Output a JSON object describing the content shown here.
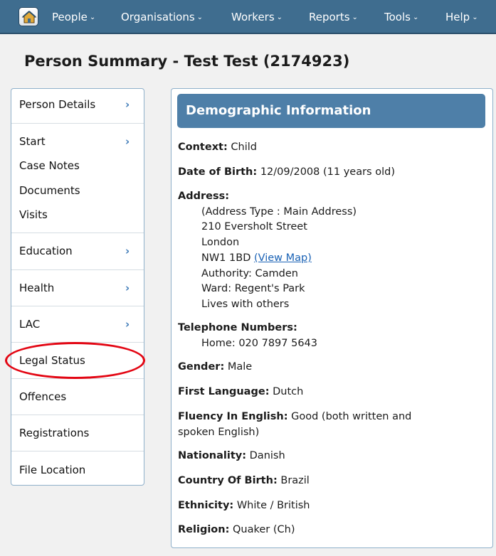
{
  "nav": {
    "items": [
      {
        "label": "People",
        "chev": "⌄"
      },
      {
        "label": "Organisations",
        "chev": "⌄"
      },
      {
        "label": "Workers",
        "chev": "⌄"
      },
      {
        "label": "Reports",
        "chev": "⌄"
      },
      {
        "label": "Tools",
        "chev": "⌄"
      },
      {
        "label": "Help",
        "chev": "⌄"
      }
    ],
    "home_icon": "home-icon"
  },
  "page_title": "Person Summary - Test Test (2174923)",
  "sidebar": {
    "items": [
      {
        "label": "Person Details",
        "arrow": "›"
      },
      {
        "label": "Start",
        "arrow": "›"
      },
      {
        "label": "Case Notes"
      },
      {
        "label": "Documents"
      },
      {
        "label": "Visits"
      },
      {
        "label": "Education",
        "arrow": "›"
      },
      {
        "label": "Health",
        "arrow": "›"
      },
      {
        "label": "LAC",
        "arrow": "›"
      },
      {
        "label": "Legal Status"
      },
      {
        "label": "Offences"
      },
      {
        "label": "Registrations"
      },
      {
        "label": "File Location"
      }
    ],
    "highlight_color": "#e30613"
  },
  "demographics": {
    "header": "Demographic Information",
    "context": {
      "label": "Context",
      "value": "Child"
    },
    "dob": {
      "label": "Date of Birth",
      "value": "12/09/2008 (11 years old)"
    },
    "address": {
      "label": "Address",
      "lines": [
        "(Address Type : Main Address)",
        "210 Eversholt Street",
        "London",
        "NW1 1BD"
      ],
      "map_link": "(View Map)",
      "extra": [
        "Authority: Camden",
        "Ward: Regent's Park",
        "Lives with others"
      ]
    },
    "telephone": {
      "label": "Telephone Numbers",
      "value": "Home: 020 7897 5643"
    },
    "gender": {
      "label": "Gender",
      "value": "Male"
    },
    "first_language": {
      "label": "First Language",
      "value": "Dutch"
    },
    "fluency": {
      "label": "Fluency In English",
      "value_line1": "Good (both written and",
      "value_line2": "spoken English)"
    },
    "nationality": {
      "label": "Nationality",
      "value": "Danish"
    },
    "country_of_birth": {
      "label": "Country Of Birth",
      "value": "Brazil"
    },
    "ethnicity": {
      "label": "Ethnicity",
      "value": "White / British"
    },
    "religion": {
      "label": "Religion",
      "value": "Quaker (Ch)"
    }
  }
}
